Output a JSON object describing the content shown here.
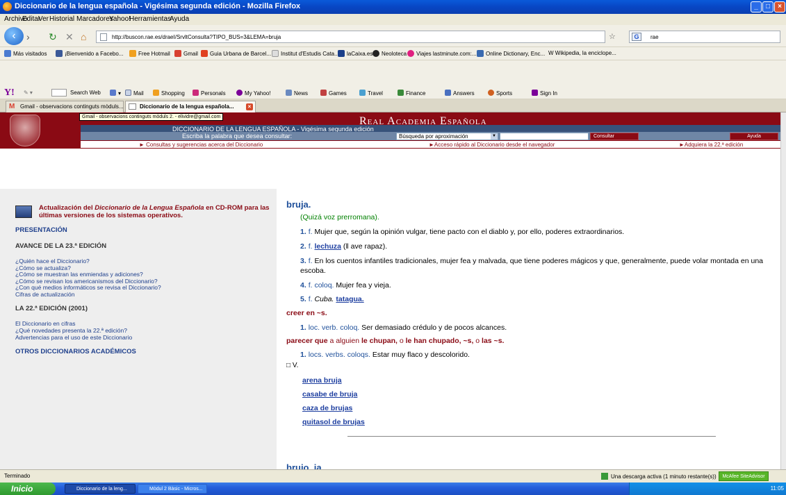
{
  "window": {
    "title": "Diccionario de la lengua española - Vigésima segunda edición - Mozilla Firefox"
  },
  "menu": [
    "Archivo",
    "Editar",
    "Ver",
    "Historial",
    "Marcadores",
    "Yahoo!",
    "Herramientas",
    "Ayuda"
  ],
  "nav": {
    "url": "http://buscon.rae.es/draeI/SrvltConsulta?TIPO_BUS=3&LEMA=bruja",
    "search_value": "rae"
  },
  "bookmarks": [
    {
      "label": "Más visitados",
      "color": "#4a7bd0"
    },
    {
      "label": "¡Bienvenido a Facebo...",
      "color": "#3b5998"
    },
    {
      "label": "Free Hotmail",
      "color": "#f0a020"
    },
    {
      "label": "Gmail",
      "color": "#d84030"
    },
    {
      "label": "Guia Urbana de Barcel...",
      "color": "#e04020"
    },
    {
      "label": "Institut d'Estudis Cata...",
      "color": "#dddddd"
    },
    {
      "label": "laCaixa.es",
      "color": "#1a3f8a"
    },
    {
      "label": "Neoloteca",
      "color": "#222222"
    },
    {
      "label": "Viajes lastminute.com:...",
      "color": "#e02080"
    },
    {
      "label": "Online Dictionary, Enc...",
      "color": "#3a6ab0"
    },
    {
      "label": "W Wikipedia, la enciclope...",
      "color": "#eeeeee"
    }
  ],
  "yahoo": {
    "logo": "Y!",
    "items": [
      "Search Web",
      "Mail",
      "Shopping",
      "Personals",
      "My Yahoo!",
      "News",
      "Games",
      "Travel",
      "Finance",
      "Answers",
      "Sports",
      "Sign In"
    ]
  },
  "tabs": [
    {
      "label": "Gmail - observacions continguts mòduls..."
    },
    {
      "label": "Diccionario de la lengua española..."
    }
  ],
  "tooltip": "Gmail - observacions continguts mòduls 2. - elividre@gmail.com",
  "rae": {
    "title": "Real Academia Española",
    "subtitle": "DICCIONARIO DE LA LENGUA ESPAÑOLA - Vigésima segunda edición",
    "prompt": "Escriba la palabra que desea consultar:",
    "search_mode": "Búsqueda por aproximación",
    "consultar": "Consultar",
    "ayuda": "Ayuda",
    "links": [
      "► Consultas y sugerencias acerca del Diccionario",
      "►Acceso rápido al Diccionario desde el navegador",
      "►Adquiera la 22.ª edición"
    ]
  },
  "sidebar": {
    "cd_prefix": "Actualización del ",
    "cd_title": "Diccionario de la Lengua Española",
    "cd_suffix": " en CD-ROM para las últimas versiones de los sistemas operativos.",
    "presentacion": "PRESENTACIÓN",
    "avance": "AVANCE DE LA 23.ª EDICIÓN",
    "avance_links": [
      "¿Quién hace el Diccionario?",
      "¿Cómo se actualiza?",
      "¿Cómo se muestran las enmiendas y adiciones?",
      "¿Cómo se revisan los americanismos del Diccionario?",
      "¿Con qué medios informáticos se revisa el Diccionario?",
      "Cifras de actualización"
    ],
    "edicion22": "LA 22.ª EDICIÓN (2001)",
    "edicion22_links": [
      "El Diccionario en cifras",
      "¿Qué novedades presenta la 22.ª edición?",
      "Advertencias para el uso de este Diccionario"
    ],
    "otros": "OTROS DICCIONARIOS ACADÉMICOS"
  },
  "entry": {
    "headword": "bruja.",
    "etymology": "(Quizá voz prerromana).",
    "senses": [
      {
        "num": "1.",
        "abbr": "f.",
        "text": " Mujer que, según la opinión vulgar, tiene pacto con el diablo y, por ello, poderes extraordinarios."
      },
      {
        "num": "2.",
        "abbr": "f.",
        "link": "lechuza",
        "text": " (‖ ave rapaz)."
      },
      {
        "num": "3.",
        "abbr": "f.",
        "text": " En los cuentos infantiles tradicionales, mujer fea y malvada, que tiene poderes mágicos y que, generalmente, puede volar montada en una escoba."
      },
      {
        "num": "4.",
        "abbr": "f. coloq.",
        "text": " Mujer fea y vieja."
      },
      {
        "num": "5.",
        "abbr": "f.",
        "region": "Cuba.",
        "link": "tatagua."
      }
    ],
    "phrase1": "creer en ~s.",
    "phrase1_sense": {
      "num": "1.",
      "abbr": "loc. verb. coloq.",
      "text": " Ser demasiado crédulo y de pocos alcances."
    },
    "phrase2_a": "parecer que",
    "phrase2_b": " a alguien ",
    "phrase2_c": "le chupan,",
    "phrase2_d": " o ",
    "phrase2_e": "le han chupado, ~s,",
    "phrase2_f": " o ",
    "phrase2_g": "las ~s.",
    "phrase2_sense": {
      "num": "1.",
      "abbr": "locs. verbs. coloqs.",
      "text": " Estar muy flaco y descolorido."
    },
    "v_marker": "□ V.",
    "v_links": [
      "arena bruja",
      "casabe de bruja",
      "caza de brujas",
      "quitasol de brujas"
    ],
    "next_headword": "brujo, ja."
  },
  "status": {
    "left": "Terminado",
    "download": "Una descarga activa (1 minuto restante(s))",
    "mcafee": "McAfee SiteAdvisor"
  },
  "taskbar": {
    "start": "Inicio",
    "tasks": [
      "Diccionario de la leng...",
      "Mòdul 2 Bàsic - Micros..."
    ],
    "clock": "11:05"
  }
}
